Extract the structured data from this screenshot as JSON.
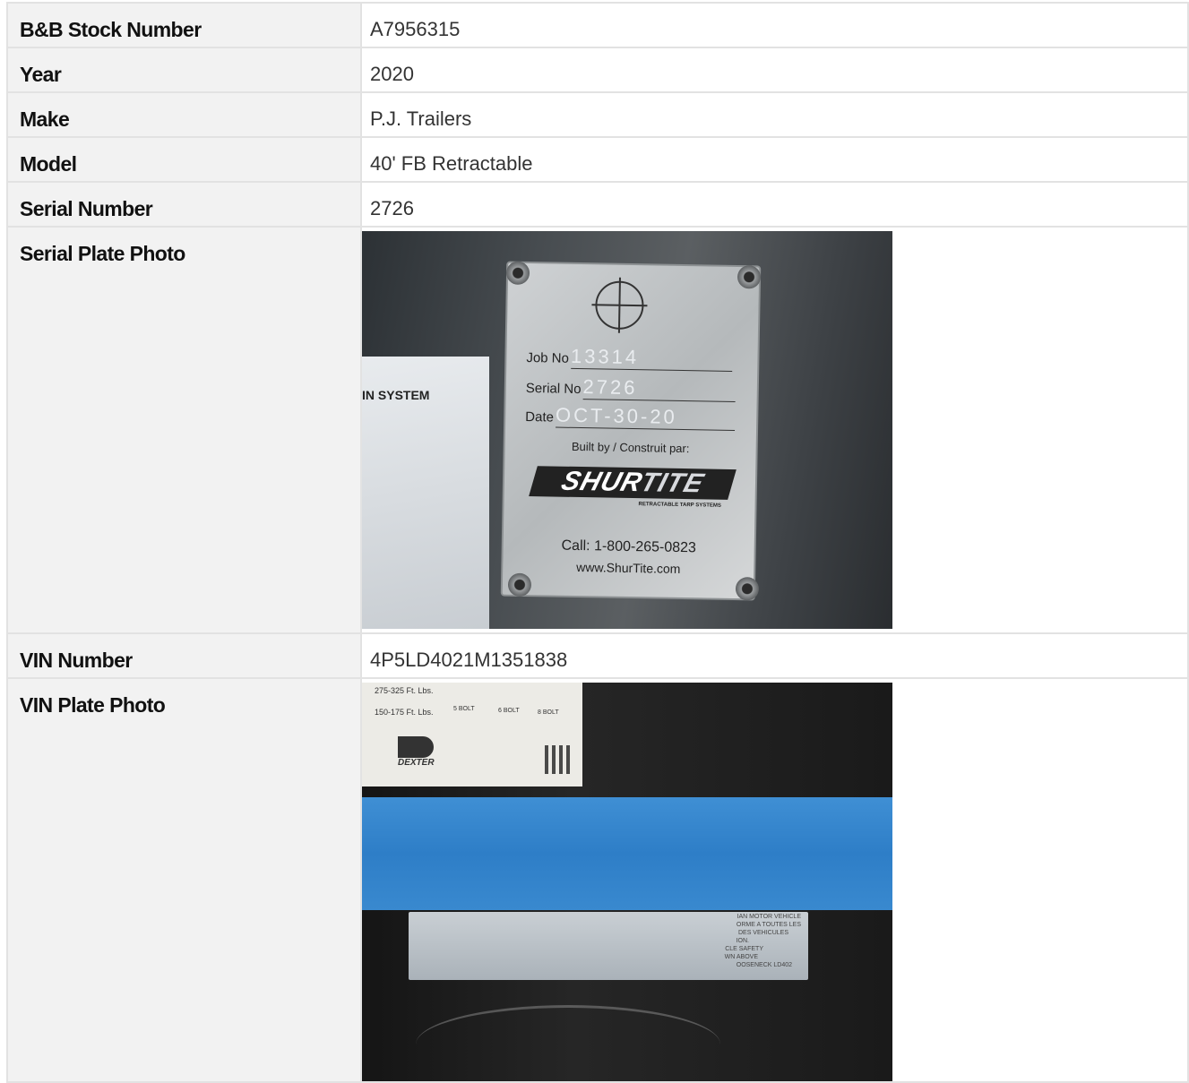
{
  "rows": [
    {
      "label": "B&B Stock Number",
      "value": "A7956315"
    },
    {
      "label": "Year",
      "value": "2020"
    },
    {
      "label": "Make",
      "value": "P.J. Trailers"
    },
    {
      "label": "Model",
      "value": "40' FB Retractable"
    },
    {
      "label": "Serial Number",
      "value": "2726"
    }
  ],
  "serial_plate": {
    "label": "Serial Plate Photo",
    "sticker_text": "IN SYSTEM",
    "job_label": "Job No",
    "job_value": "13314",
    "serial_label": "Serial No",
    "serial_value": "2726",
    "date_label": "Date",
    "date_value": "OCT-30-20",
    "built_by": "Built by / Construit par:",
    "logo_shur": "SHUR",
    "logo_tite": "TITE",
    "tagline": "RETRACTABLE TARP SYSTEMS",
    "phone": "Call: 1-800-265-0823",
    "website": "www.ShurTite.com"
  },
  "vin": {
    "label": "VIN Number",
    "value": "4P5LD4021M1351838"
  },
  "vin_plate": {
    "label": "VIN Plate Photo",
    "torque_1": "275-325 Ft. Lbs.",
    "torque_2": "150-175 Ft. Lbs.",
    "bolt_5": "5 BOLT",
    "bolt_6": "6 BOLT",
    "bolt_8": "8 BOLT",
    "dexter": "DEXTER",
    "vin_lines": [
      "IAN MOTOR VEHICLE",
      "ORME A TOUTES LES",
      "DES VEHICULES",
      "ION.",
      "CLE SAFETY",
      "WN ABOVE",
      "OOSENECK LD402"
    ]
  }
}
